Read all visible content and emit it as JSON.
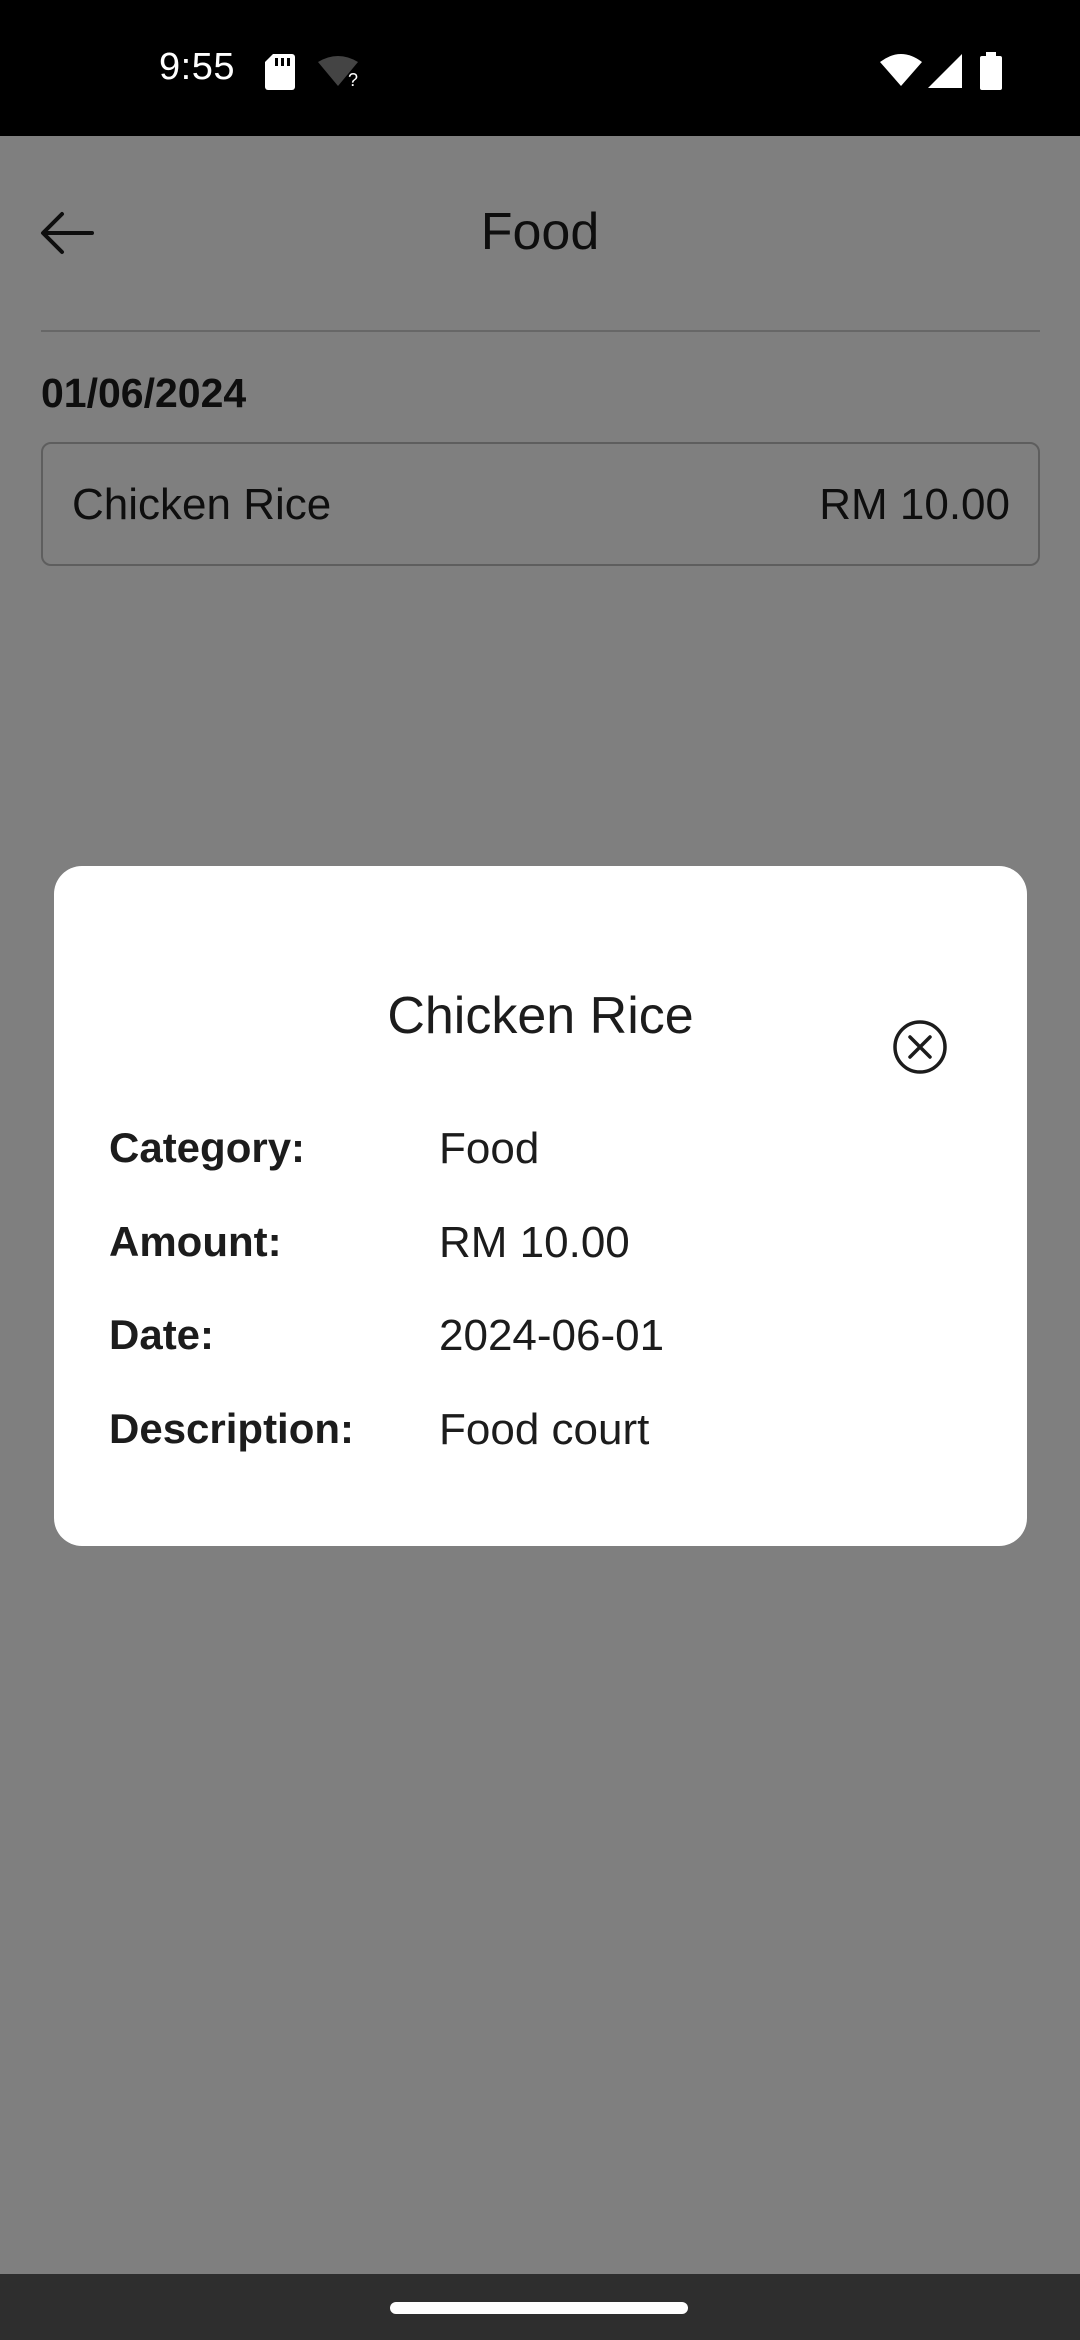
{
  "status_bar": {
    "time": "9:55",
    "icons": [
      "sd-card-icon",
      "wifi-unknown-icon",
      "wifi-icon",
      "signal-icon",
      "battery-icon"
    ]
  },
  "app_bar": {
    "title": "Food",
    "back_icon": "arrow-left-icon"
  },
  "list": {
    "date_heading": "01/06/2024",
    "items": [
      {
        "name": "Chicken Rice",
        "amount": "RM 10.00"
      }
    ]
  },
  "dialog": {
    "title": "Chicken Rice",
    "close_icon": "close-circle-icon",
    "rows": [
      {
        "label": "Category:",
        "value": "Food"
      },
      {
        "label": "Amount:",
        "value": "RM 10.00"
      },
      {
        "label": "Date:",
        "value": "2024-06-01"
      },
      {
        "label": "Description:",
        "value": "Food court"
      }
    ]
  },
  "colors": {
    "status_bar": "#000000",
    "scrim": "#7f7f7f",
    "text": "#1c1c1c",
    "nav_bar": "#2e2e2e"
  }
}
